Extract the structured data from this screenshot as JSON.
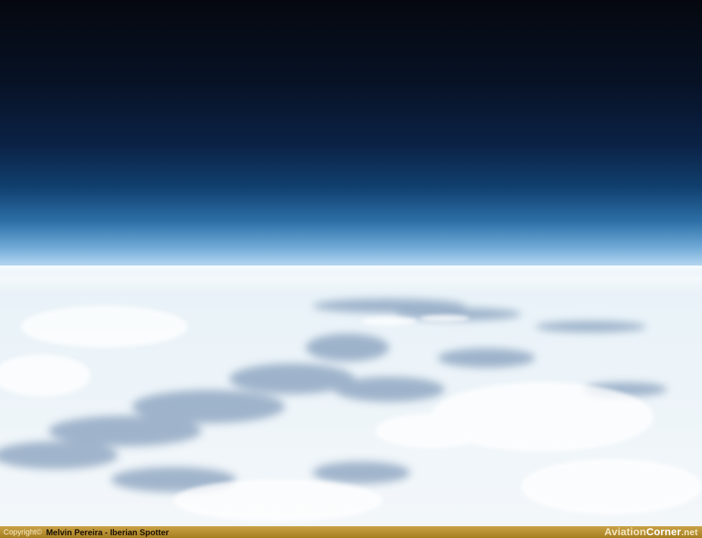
{
  "photo": {
    "subject": "high-altitude view of the sky above a cloud layer",
    "colors": {
      "space": "#05080f",
      "upper_sky": "#0b2246",
      "horizon_blue": "#6ea8d6",
      "cloud_white": "#f3f7fa",
      "cloud_shadow": "#5f7fa6"
    }
  },
  "credit_bar": {
    "copyright_label": "Copyright©",
    "author": "Melvin Pereira - Iberian Spotter",
    "site_name": {
      "part1": "Aviation",
      "part2": "Corner",
      "part3": ".net"
    },
    "colors": {
      "bar": "#c9a246",
      "text_dark": "#1b1204",
      "text_light": "#f3e7c2"
    }
  }
}
